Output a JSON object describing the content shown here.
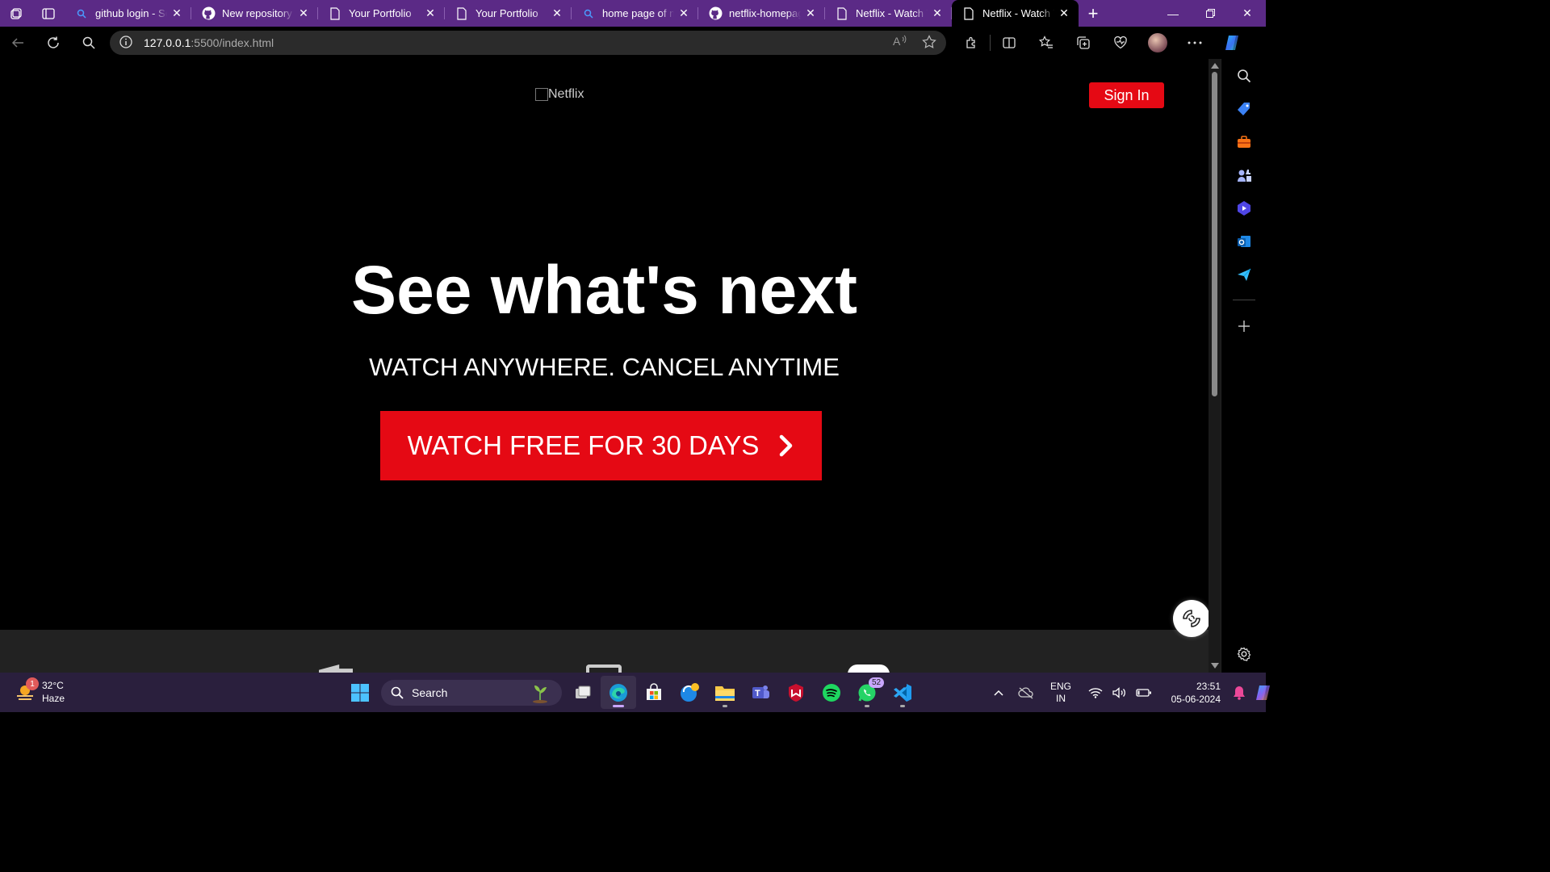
{
  "browser": {
    "tabs": [
      {
        "title": "github login - Se",
        "icon": "search-icon"
      },
      {
        "title": "New repository",
        "icon": "github-icon"
      },
      {
        "title": "Your Portfolio",
        "icon": "page-icon"
      },
      {
        "title": "Your Portfolio",
        "icon": "page-icon"
      },
      {
        "title": "home page of ne",
        "icon": "search-icon"
      },
      {
        "title": "netflix-homepag",
        "icon": "github-icon"
      },
      {
        "title": "Netflix - Watch T",
        "icon": "page-icon"
      },
      {
        "title": "Netflix - Watch T",
        "icon": "page-icon",
        "active": true
      }
    ],
    "address": {
      "host": "127.0.0.1",
      "path": ":5500/index.html"
    }
  },
  "page": {
    "logo_alt": "Netflix",
    "signin_label": "Sign In",
    "hero_title": "See what's next",
    "hero_subtitle": "WATCH ANYWHERE. CANCEL ANYTIME",
    "cta_label": "WATCH FREE FOR 30 DAYS"
  },
  "colors": {
    "brand_red": "#e50914",
    "tab_strip": "#5b2a86",
    "taskbar": "#2a1f3d"
  },
  "taskbar": {
    "weather": {
      "temp": "32°C",
      "condition": "Haze",
      "badge": "1"
    },
    "search_label": "Search",
    "whatsapp_badge": "52",
    "lang": {
      "line1": "ENG",
      "line2": "IN"
    },
    "clock": {
      "time": "23:51",
      "date": "05-06-2024"
    }
  }
}
